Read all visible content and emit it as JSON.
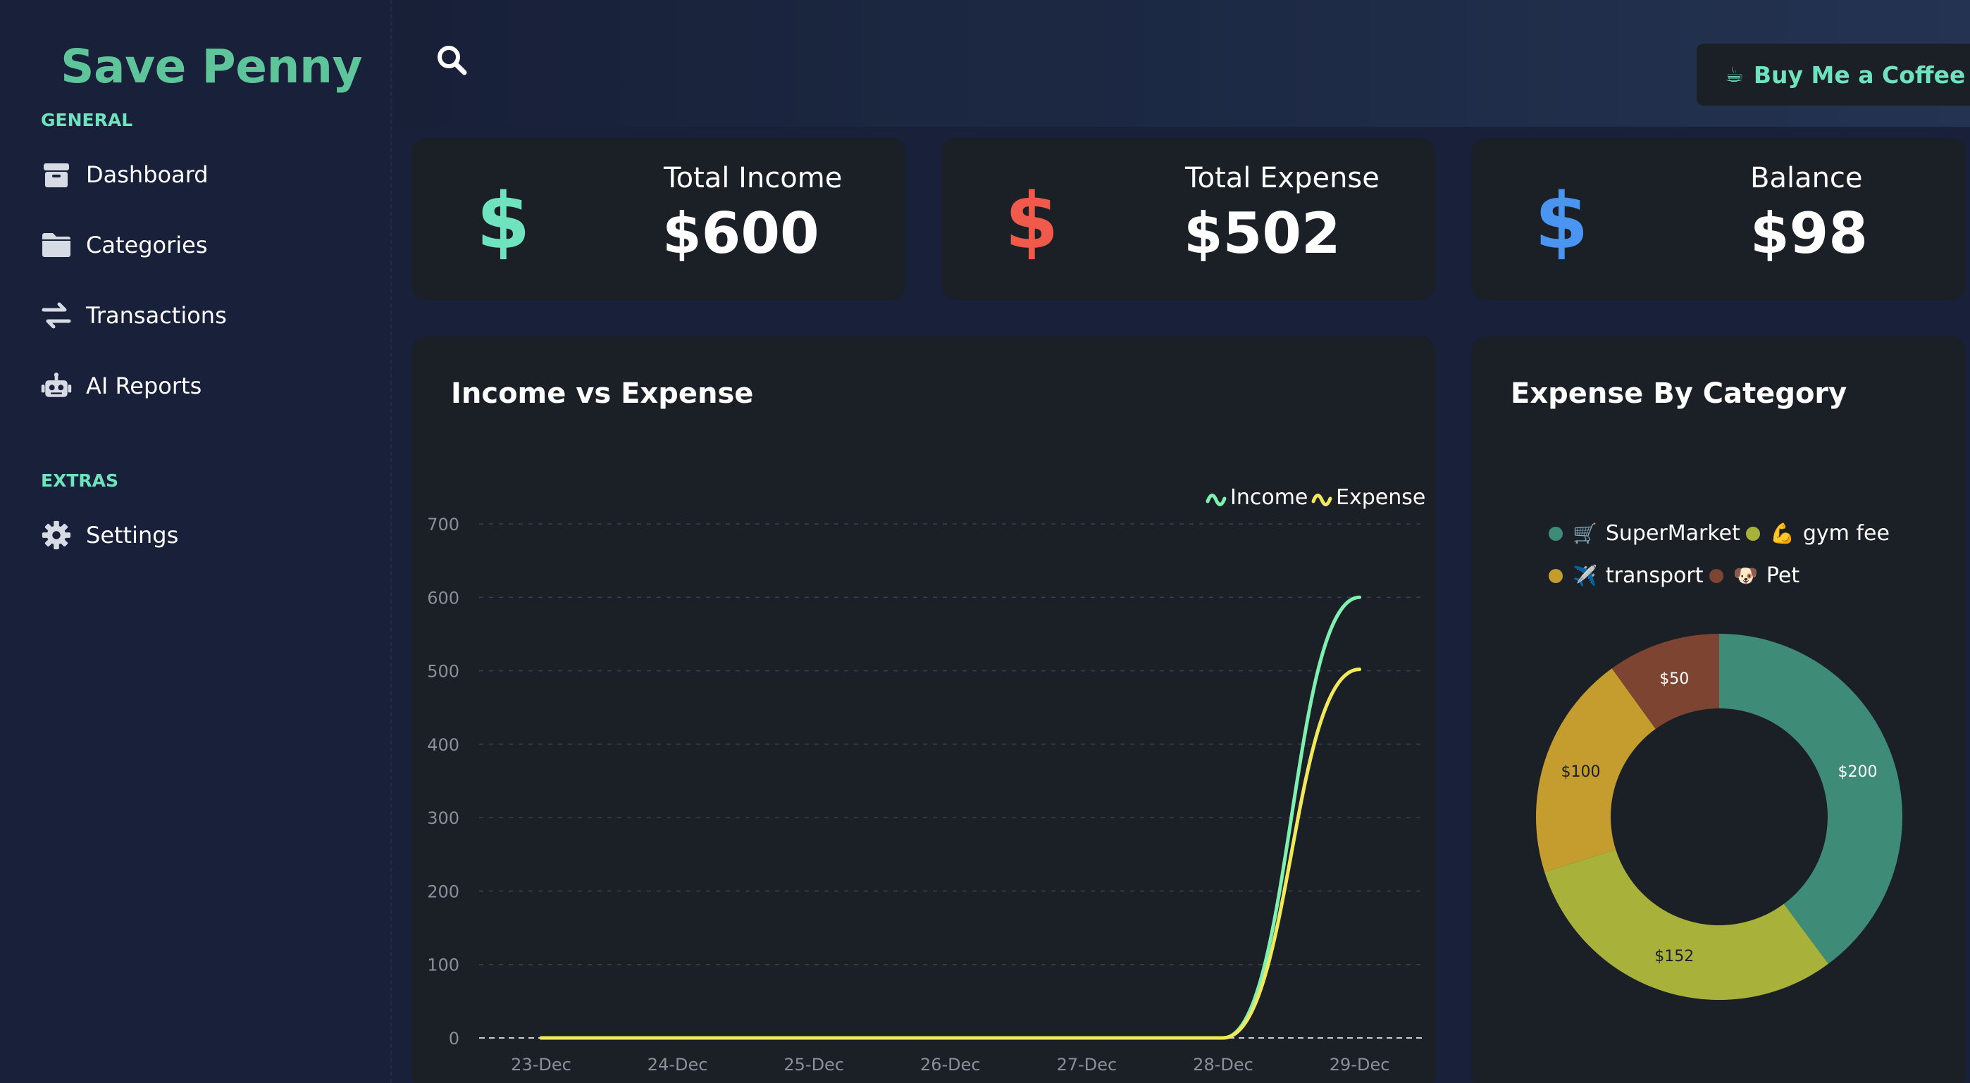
{
  "app": {
    "title": "Save Penny"
  },
  "sidebar": {
    "general_label": "GENERAL",
    "extras_label": "EXTRAS",
    "items": [
      {
        "label": "Dashboard",
        "icon": "box-icon"
      },
      {
        "label": "Categories",
        "icon": "folder-icon"
      },
      {
        "label": "Transactions",
        "icon": "arrows-exchange-icon"
      },
      {
        "label": "AI Reports",
        "icon": "robot-icon"
      }
    ],
    "extras": [
      {
        "label": "Settings",
        "icon": "gear-icon"
      }
    ]
  },
  "topbar": {
    "search_icon": "search-icon",
    "coffee_label": "Buy Me a Coffee",
    "coffee_icon": "☕"
  },
  "stats": [
    {
      "title": "Total Income",
      "value": "$600",
      "symbol": "$",
      "color": "#6fe3bd"
    },
    {
      "title": "Total Expense",
      "value": "$502",
      "symbol": "$",
      "color": "#ef5a4a"
    },
    {
      "title": "Balance",
      "value": "$98",
      "symbol": "$",
      "color": "#4a94f2"
    }
  ],
  "income_chart": {
    "title": "Income vs Expense",
    "chart_data": {
      "type": "line",
      "categories": [
        "23-Dec",
        "24-Dec",
        "25-Dec",
        "26-Dec",
        "27-Dec",
        "28-Dec",
        "29-Dec"
      ],
      "ylim": [
        0,
        700
      ],
      "yticks": [
        "0",
        "100",
        "200",
        "300",
        "400",
        "500",
        "600",
        "700"
      ],
      "series": [
        {
          "name": "Income",
          "color": "#7ef0b0",
          "values": [
            0,
            0,
            0,
            0,
            0,
            0,
            600
          ]
        },
        {
          "name": "Expense",
          "color": "#f2e85c",
          "values": [
            0,
            0,
            0,
            0,
            0,
            0,
            502
          ]
        }
      ],
      "grid": true,
      "legend": "top-right"
    }
  },
  "category_chart": {
    "title": "Expense By Category",
    "chart_data": {
      "type": "pie",
      "donut": true,
      "slices": [
        {
          "name": "SuperMarket",
          "emoji": "🛒",
          "value": 200,
          "label": "$200",
          "color": "#3e8c78"
        },
        {
          "name": "gym fee",
          "emoji": "💪",
          "value": 152,
          "label": "$152",
          "color": "#a8b23a"
        },
        {
          "name": "transport",
          "emoji": "✈️",
          "value": 100,
          "label": "$100",
          "color": "#c49d2e"
        },
        {
          "name": "Pet",
          "emoji": "🐶",
          "value": 50,
          "label": "$50",
          "color": "#7d4531"
        }
      ],
      "legend": "top"
    }
  }
}
